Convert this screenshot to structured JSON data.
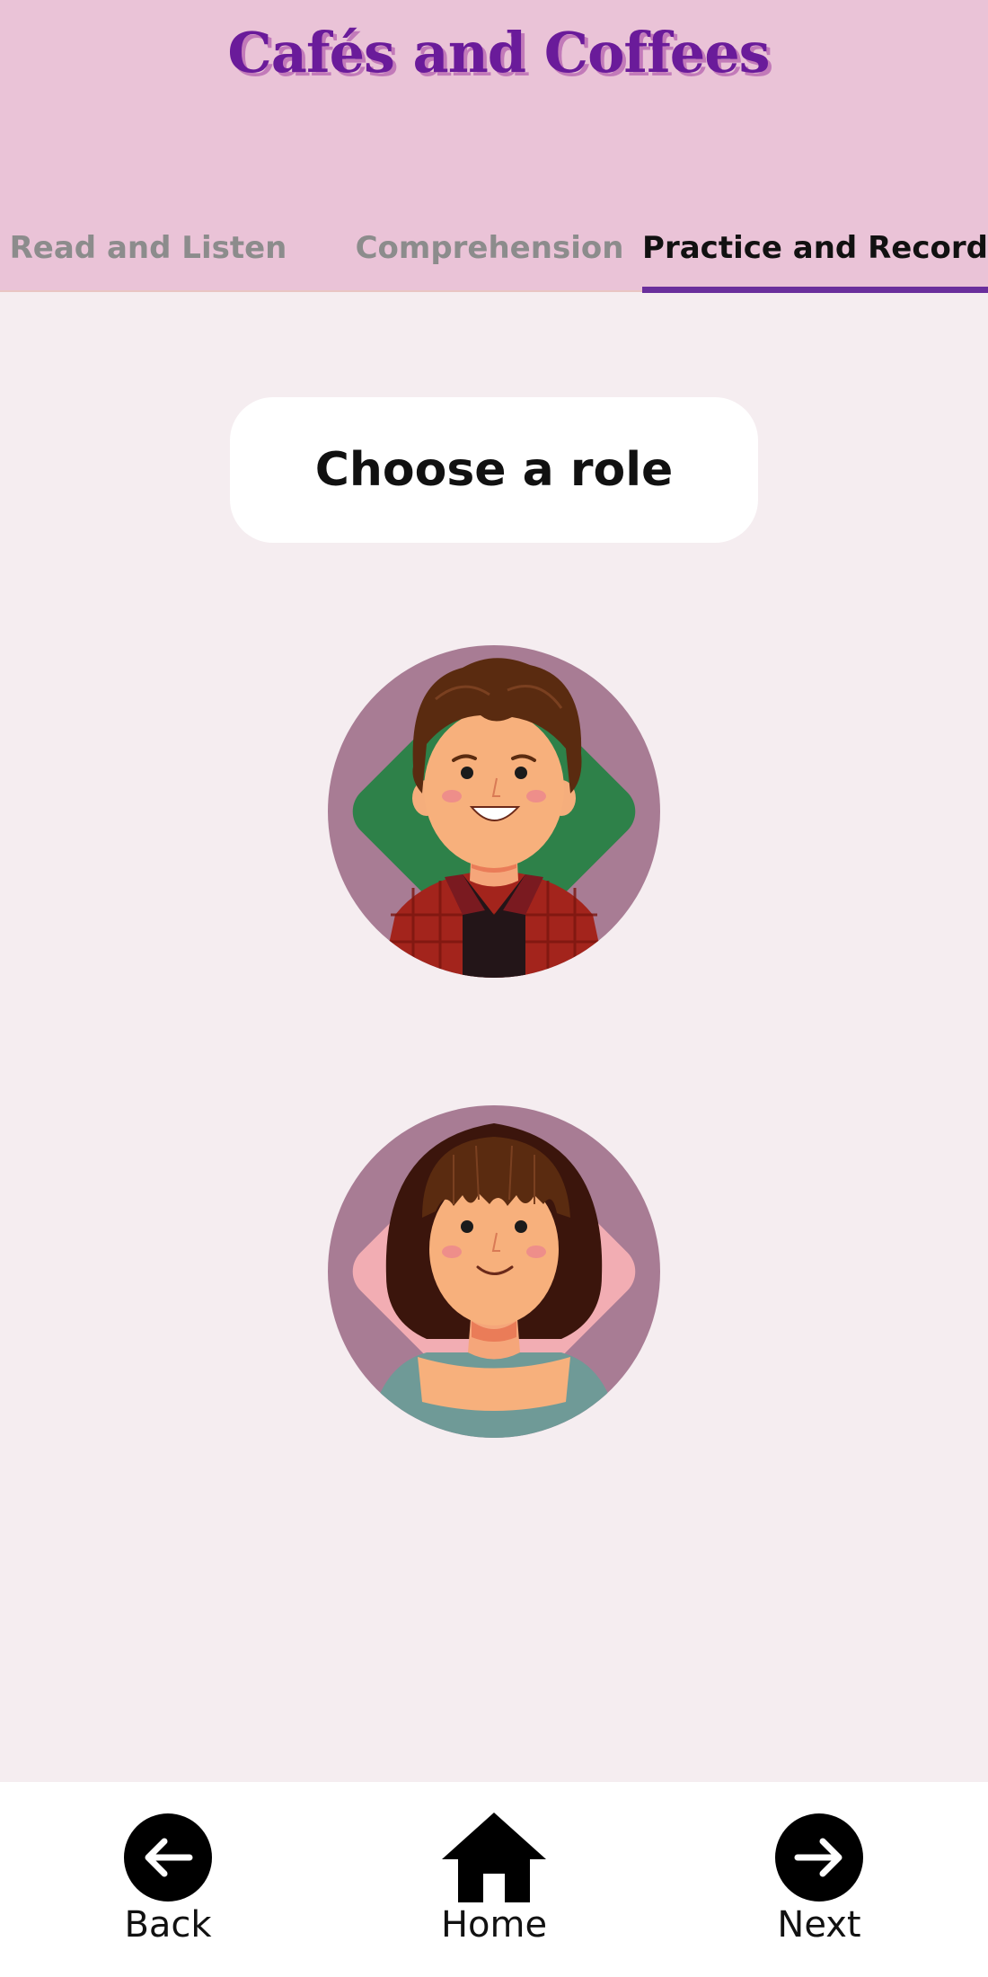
{
  "header": {
    "title": "Cafés and Coffees",
    "tabs": [
      {
        "label": "Read and Listen",
        "active": false
      },
      {
        "label": "Comprehension",
        "active": false
      },
      {
        "label": "Practice and Record",
        "active": true
      }
    ]
  },
  "main": {
    "prompt": "Choose a role",
    "roles": [
      {
        "icon": "boy-avatar-icon"
      },
      {
        "icon": "girl-avatar-icon"
      }
    ]
  },
  "bottom_nav": {
    "back_label": "Back",
    "home_label": "Home",
    "next_label": "Next"
  },
  "colors": {
    "header_bg": "#eac3d7",
    "title": "#6a1b9a",
    "active_tab_underline": "#6a2f9c",
    "page_bg": "#f5edf0"
  }
}
